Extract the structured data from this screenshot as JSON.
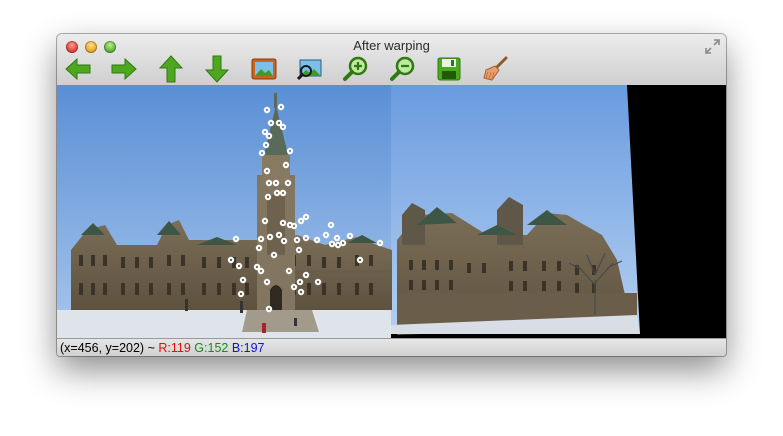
{
  "window": {
    "title": "After warping"
  },
  "toolbar": {
    "buttons": [
      {
        "name": "pan-left-button",
        "icon": "arrow-left-icon"
      },
      {
        "name": "pan-right-button",
        "icon": "arrow-right-icon"
      },
      {
        "name": "pan-up-button",
        "icon": "arrow-up-icon"
      },
      {
        "name": "pan-down-button",
        "icon": "arrow-down-icon"
      },
      {
        "name": "zoom-fit-button",
        "icon": "image-icon"
      },
      {
        "name": "zoom-area-button",
        "icon": "zoom-region-icon"
      },
      {
        "name": "zoom-in-button",
        "icon": "zoom-in-icon"
      },
      {
        "name": "zoom-out-button",
        "icon": "zoom-out-icon"
      },
      {
        "name": "save-button",
        "icon": "save-icon"
      },
      {
        "name": "properties-button",
        "icon": "broom-icon"
      }
    ]
  },
  "status": {
    "coords": "(x=456, y=202)",
    "separator": "~",
    "r": "R:119",
    "g": "G:152",
    "b": "B:197"
  },
  "colors": {
    "status_r": "#e01010",
    "status_g": "#10901a",
    "status_b": "#1010e0",
    "toolbar_green": "#4da81f"
  },
  "image": {
    "description_icon": "photo-icon"
  }
}
